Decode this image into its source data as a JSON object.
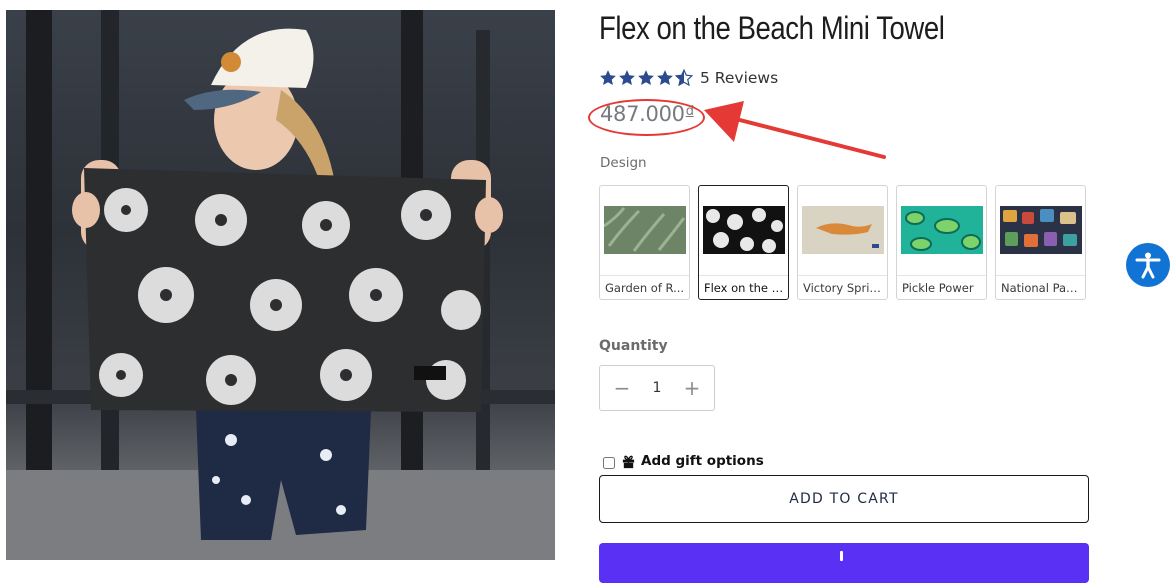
{
  "product": {
    "title": "Flex on the Beach Mini Towel",
    "rating": 4.5,
    "reviews_text": "5 Reviews",
    "price": "487.000",
    "currency_symbol": "đ",
    "design_label": "Design",
    "designs": [
      {
        "name": "Garden of R...",
        "selected": false
      },
      {
        "name": "Flex on the B...",
        "selected": true
      },
      {
        "name": "Victory Sprints",
        "selected": false
      },
      {
        "name": "Pickle Power",
        "selected": false
      },
      {
        "name": "National Parks",
        "selected": false
      }
    ],
    "quantity_label": "Quantity",
    "quantity": "1",
    "gift_label": "Add gift options",
    "add_to_cart_label": "ADD TO CART"
  },
  "colors": {
    "star": "#2b4a8f",
    "annotation": "#e53935",
    "buy_now": "#5a31f4",
    "accessibility": "#1173d4"
  },
  "icons": {
    "accessibility": "accessibility-icon",
    "gift": "gift-icon",
    "minus": "minus-icon",
    "plus": "plus-icon"
  }
}
